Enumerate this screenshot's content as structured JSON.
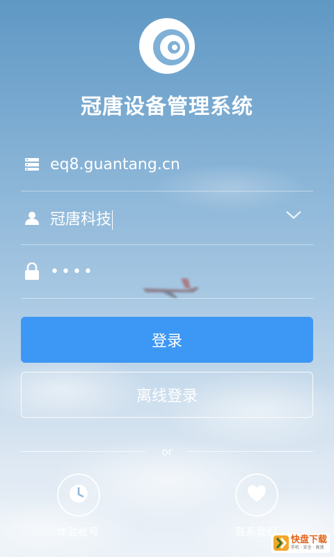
{
  "app": {
    "title": "冠唐设备管理系统"
  },
  "form": {
    "server": {
      "value": "eq8.guantang.cn",
      "icon": "server-icon"
    },
    "username": {
      "value": "冠唐科技",
      "icon": "user-icon",
      "dropdown_icon": "chevron-down-icon"
    },
    "password": {
      "value": "••••",
      "icon": "lock-icon"
    }
  },
  "buttons": {
    "login": "登录",
    "offline_login": "离线登录"
  },
  "divider": {
    "text": "or"
  },
  "quick_actions": [
    {
      "label": "体验帐号",
      "icon": "clock-icon"
    },
    {
      "label": "联系我们",
      "icon": "heart-icon"
    }
  ],
  "watermark": {
    "brand": "快盘下载",
    "tagline": "手机 · 安全 · 高速"
  },
  "colors": {
    "primary_button": "#3d97f5",
    "text": "#ffffff",
    "watermark_accent": "#e2641c"
  }
}
